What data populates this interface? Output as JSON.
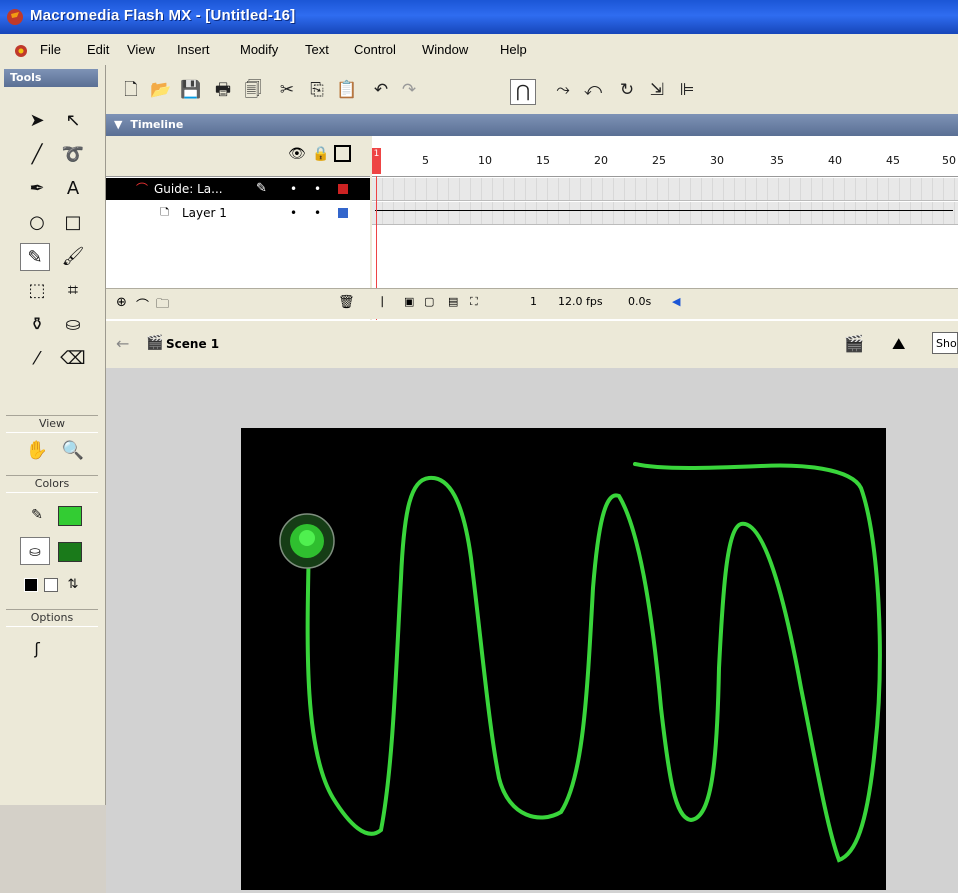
{
  "window": {
    "title": "Macromedia Flash MX - [Untitled-16]"
  },
  "menu": [
    "File",
    "Edit",
    "View",
    "Insert",
    "Modify",
    "Text",
    "Control",
    "Window",
    "Help"
  ],
  "tools": {
    "header": "Tools",
    "sections": {
      "view": "View",
      "colors": "Colors",
      "options": "Options"
    },
    "stroke_color": "#33cc33",
    "fill_color": "#1a7a1a"
  },
  "timeline": {
    "header": "Timeline",
    "ruler": [
      "5",
      "10",
      "15",
      "20",
      "25",
      "30",
      "35",
      "40",
      "45",
      "50"
    ],
    "current_frame_marker": "1",
    "layers": [
      {
        "name": "Guide: La...",
        "type": "guide",
        "color": "#cc2222",
        "selected": true
      },
      {
        "name": "Layer 1",
        "type": "normal",
        "color": "#3366cc",
        "selected": false
      }
    ],
    "footer": {
      "frame": "1",
      "fps": "12.0 fps",
      "time": "0.0s"
    }
  },
  "scene": {
    "name": "Scene 1",
    "view_dropdown": "Sho"
  },
  "stage": {
    "background": "#000000",
    "path_color": "#39d53b",
    "ball_color": "#2fbf2f"
  }
}
